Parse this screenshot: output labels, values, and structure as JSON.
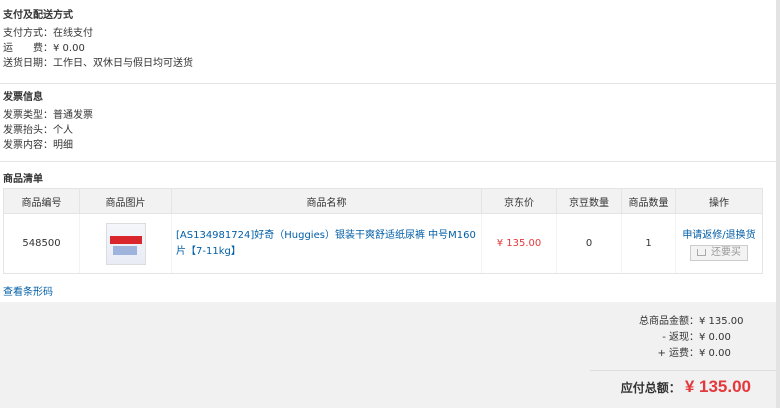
{
  "payment": {
    "title": "支付及配送方式",
    "rows": [
      {
        "label": "支付方式：",
        "value": "在线支付"
      },
      {
        "label": "运　　费：",
        "value": "¥ 0.00"
      },
      {
        "label": "送货日期：",
        "value": "工作日、双休日与假日均可送货"
      }
    ]
  },
  "invoice": {
    "title": "发票信息",
    "rows": [
      {
        "label": "发票类型：",
        "value": "普通发票"
      },
      {
        "label": "发票抬头：",
        "value": "个人"
      },
      {
        "label": "发票内容：",
        "value": "明细"
      }
    ]
  },
  "goods": {
    "title": "商品清单",
    "headers": [
      "商品编号",
      "商品图片",
      "商品名称",
      "京东价",
      "京豆数量",
      "商品数量",
      "操作"
    ],
    "items": [
      {
        "sku": "548500",
        "image_icon": "diaper-product-image",
        "name": "[AS134981724]好奇（Huggies）银装干爽舒适纸尿裤 中号M160片【7-11kg】",
        "price": "¥ 135.00",
        "beans": "0",
        "qty": "1",
        "op_link": "申请返修/退换货",
        "rebuy": "还要买"
      }
    ],
    "barcode_link": "查看条形码"
  },
  "summary": {
    "goods_total_label": "总商品金额：",
    "goods_total": "¥ 135.00",
    "rebate_label": "- 返现：",
    "rebate": "¥ 0.00",
    "shipping_label": "+ 运费：",
    "shipping": "¥ 0.00",
    "payable_label": "应付总额：",
    "payable": "¥ 135.00"
  },
  "colors": {
    "link": "#005ea7",
    "price": "#e4393c",
    "summary_bg": "#f1f1f1"
  }
}
